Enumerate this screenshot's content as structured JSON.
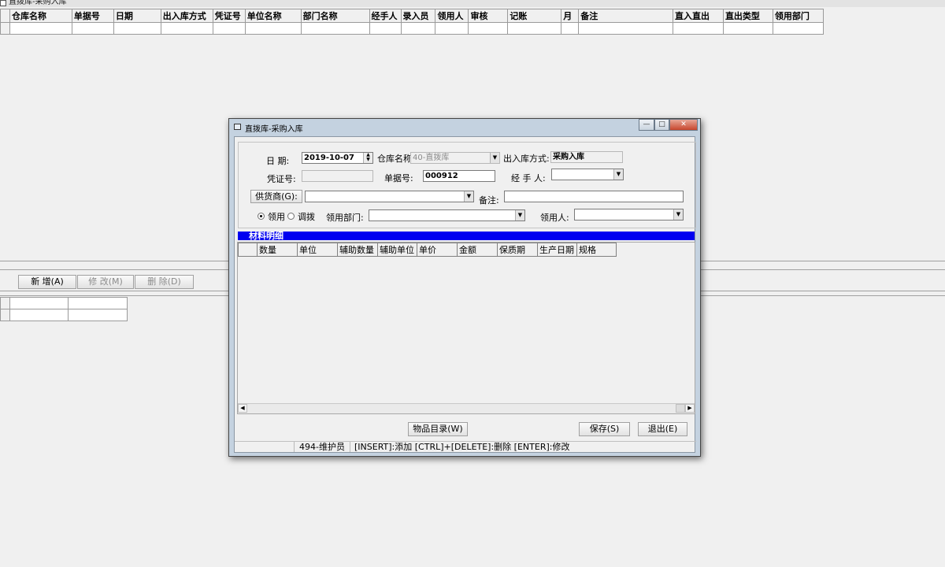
{
  "main_window": {
    "title": "直拨库-采购入库",
    "grid_headers": [
      "仓库名称",
      "单据号",
      "日期",
      "出入库方式",
      "凭证号",
      "单位名称",
      "部门名称",
      "经手人",
      "录入员",
      "领用人",
      "审核",
      "记账",
      "月",
      "备注",
      "直入直出",
      "直出类型",
      "领用部门"
    ],
    "buttons": {
      "add": "新 增(A)",
      "modify": "修 改(M)",
      "delete": "删 除(D)"
    }
  },
  "dialog": {
    "title": "直拨库-采购入库",
    "caption_buttons": {
      "minimize": "—",
      "maximize": "□",
      "close": "✕"
    },
    "form": {
      "date_label": "日  期:",
      "date_value": "2019-10-07",
      "warehouse_label": "仓库名称",
      "warehouse_value": "40-直拨库",
      "io_mode_label": "出入库方式:",
      "io_mode_value": "采购入库",
      "voucher_label": "凭证号:",
      "voucher_value": "",
      "doc_no_label": "单据号:",
      "doc_no_value": "000912",
      "handler_label": "经 手 人:",
      "handler_value": "",
      "supplier_button": "供货商(G):",
      "supplier_value": "",
      "remark_label": "备注:",
      "remark_value": "",
      "radio_use": "领用",
      "radio_transfer": "调拨",
      "dept_label": "领用部门:",
      "dept_value": "",
      "receiver_label": "领用人:",
      "receiver_value": ""
    },
    "materials_title": "材料明细",
    "detail_headers": [
      "数量",
      "单位",
      "辅助数量",
      "辅助单位",
      "单价",
      "金额",
      "保质期",
      "生产日期",
      "规格"
    ],
    "buttons": {
      "catalog": "物品目录(W)",
      "save": "保存(S)",
      "exit": "退出(E)"
    },
    "status": {
      "user": "494-维护员",
      "hint": "[INSERT]:添加 [CTRL]+[DELETE]:删除 [ENTER]:修改"
    }
  }
}
